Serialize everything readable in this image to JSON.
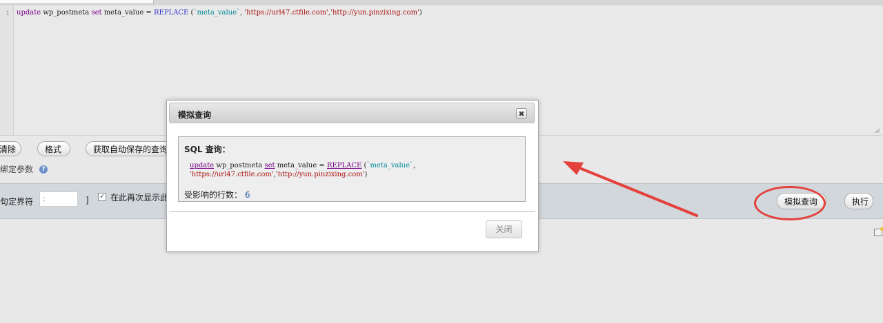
{
  "editor": {
    "line_number": "1",
    "query_parts": {
      "kw_update": "update",
      "table": " wp_postmeta ",
      "kw_set": "set",
      "col_assign": " meta_value = ",
      "fn_replace": "REPLACE",
      "open": " (",
      "ident_meta": "`meta_value`",
      "comma1": ", ",
      "str_from": "'https://url47.ctfile.com'",
      "comma2": ",",
      "str_to": "'http://yun.pinzixing.com'",
      "close": ")"
    }
  },
  "toolbar": {
    "clear_label": "清除",
    "format_label": "格式",
    "autosave_label": "获取自动保存的查询",
    "bind_params_label": "绑定参数"
  },
  "bottombar": {
    "delimiter_label": "句定界符",
    "delimiter_value": ";",
    "bracket_close": "]",
    "show_again_label": "在此再次显示此查询",
    "simulate_label": "模拟查询",
    "execute_label": "执行"
  },
  "dialog": {
    "title": "模拟查询",
    "close_x": "✖",
    "sql_heading": "SQL 查询：",
    "sql_line1": {
      "kw_update": "update",
      "table": " wp_postmeta ",
      "kw_set": "set",
      "col_assign": " meta_value = ",
      "fn_replace": "REPLACE",
      "open": " (",
      "ident_meta": "`meta_value`",
      "comma": ","
    },
    "sql_line2": {
      "str_from": "'https://url47.ctfile.com'",
      "comma": ",",
      "str_to": "'http://yun.pinzixing.com'",
      "close": ")"
    },
    "affected_label": "受影响的行数：",
    "affected_count": "6",
    "close_button": "关闭"
  },
  "colors": {
    "annotation_red": "#e4413c",
    "keyword": "#770088",
    "function": "#3333cc",
    "string": "#aa1111",
    "identifier": "#008899"
  }
}
